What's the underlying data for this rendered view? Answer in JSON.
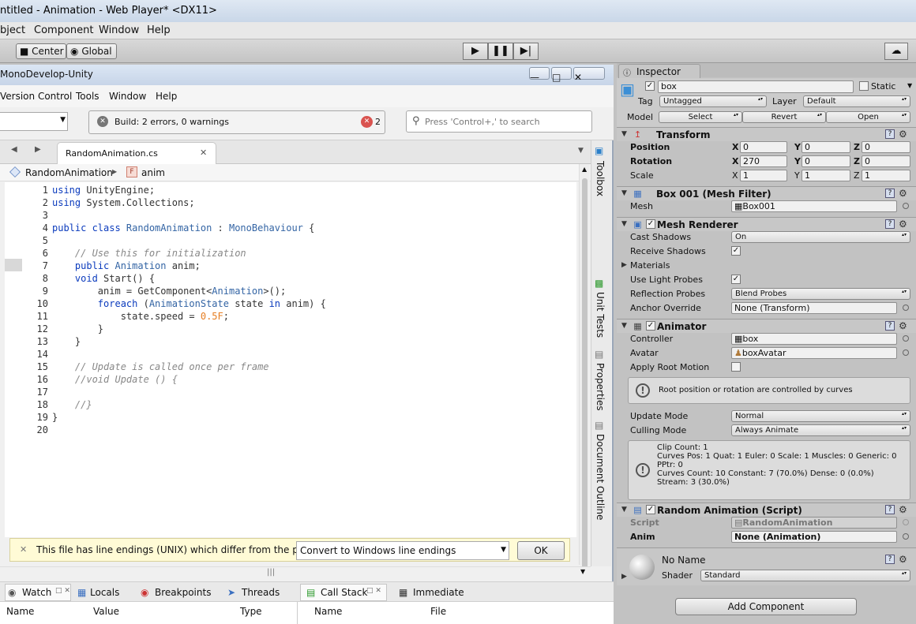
{
  "unity": {
    "title": "ntitled - Animation - Web Player* <DX11>",
    "menu": [
      "bject",
      "Component",
      "Window",
      "Help"
    ],
    "toolbar": {
      "center": "Center",
      "global": "Global"
    }
  },
  "md": {
    "title": "MonoDevelop-Unity",
    "menu": [
      "Version Control",
      "Tools",
      "Window",
      "Help"
    ],
    "build_status": "Build: 2 errors, 0 warnings",
    "error_count": "2",
    "search_placeholder": "Press 'Control+,' to search",
    "doc_tab": "RandomAnimation.cs",
    "breadcrumb_class": "RandomAnimation",
    "breadcrumb_member": "anim",
    "lines": [
      {
        "n": "1",
        "t": [
          [
            "kw",
            "using"
          ],
          [
            "",
            "UnityEngine;"
          ]
        ]
      },
      {
        "n": "2",
        "t": [
          [
            "kw",
            "using"
          ],
          [
            "",
            "System.Collections;"
          ]
        ]
      },
      {
        "n": "3",
        "t": []
      },
      {
        "n": "4",
        "t": [
          [
            "kw",
            "public class"
          ],
          [
            "ty",
            "RandomAnimation"
          ],
          [
            "",
            " : "
          ],
          [
            "ty",
            "MonoBehaviour"
          ],
          [
            "",
            " {"
          ]
        ]
      },
      {
        "n": "5",
        "t": []
      },
      {
        "n": "6",
        "t": [
          [
            "cm",
            "    // Use this for initialization"
          ]
        ]
      },
      {
        "n": "7",
        "t": [
          [
            "kw",
            "    public"
          ],
          [
            "ty",
            "Animation"
          ],
          [
            "",
            "anim;"
          ]
        ]
      },
      {
        "n": "8",
        "t": [
          [
            "kw",
            "    void"
          ],
          [
            "",
            "Start() {"
          ]
        ]
      },
      {
        "n": "9",
        "t": [
          [
            "",
            "        anim = GetComponent<"
          ],
          [
            "ty",
            "Animation"
          ],
          [
            "",
            ">();"
          ]
        ]
      },
      {
        "n": "10",
        "t": [
          [
            "kw",
            "        foreach"
          ],
          [
            "",
            " ("
          ],
          [
            "ty",
            "AnimationState"
          ],
          [
            "",
            "state "
          ],
          [
            "kw",
            "in"
          ],
          [
            "",
            "anim) {"
          ]
        ]
      },
      {
        "n": "11",
        "t": [
          [
            "",
            "            state.speed = "
          ],
          [
            "nm",
            "0.5F"
          ],
          [
            "",
            ";"
          ]
        ]
      },
      {
        "n": "12",
        "t": [
          [
            "",
            "        }"
          ]
        ]
      },
      {
        "n": "13",
        "t": [
          [
            "",
            "    }"
          ]
        ]
      },
      {
        "n": "14",
        "t": []
      },
      {
        "n": "15",
        "t": [
          [
            "cm",
            "    // Update is called once per frame"
          ]
        ]
      },
      {
        "n": "16",
        "t": [
          [
            "cm",
            "    //void Update () {"
          ]
        ]
      },
      {
        "n": "17",
        "t": []
      },
      {
        "n": "18",
        "t": [
          [
            "cm",
            "    //}"
          ]
        ]
      },
      {
        "n": "19",
        "t": [
          [
            "",
            "}"
          ]
        ]
      },
      {
        "n": "20",
        "t": []
      }
    ],
    "side_pads": [
      "Toolbox",
      "Unit Tests",
      "Properties",
      "Document Outline"
    ],
    "info_message": "This file has line endings (UNIX) which differ from the polic...",
    "convert_option": "Convert to Windows line endings",
    "ok": "OK",
    "pads": [
      "Watch",
      "Locals",
      "Breakpoints",
      "Threads",
      "Call Stack",
      "Immediate"
    ],
    "cols_left": [
      "Name",
      "Value",
      "Type"
    ],
    "cols_right": [
      "Name",
      "File"
    ]
  },
  "inspector": {
    "tab": "Inspector",
    "object_name": "box",
    "static": "Static",
    "tag_label": "Tag",
    "tag": "Untagged",
    "layer_label": "Layer",
    "layer": "Default",
    "model_label": "Model",
    "model_buttons": [
      "Select",
      "Revert",
      "Open"
    ],
    "transform": {
      "title": "Transform",
      "position": {
        "label": "Position",
        "x": "0",
        "y": "0",
        "z": "0"
      },
      "rotation": {
        "label": "Rotation",
        "x": "270",
        "y": "0",
        "z": "0"
      },
      "scale": {
        "label": "Scale",
        "x": "1",
        "y": "1",
        "z": "1"
      }
    },
    "mesh_filter": {
      "title": "Box 001 (Mesh Filter)",
      "mesh_label": "Mesh",
      "mesh": "Box001"
    },
    "mesh_renderer": {
      "title": "Mesh Renderer",
      "cast_label": "Cast Shadows",
      "cast": "On",
      "receive_label": "Receive Shadows",
      "materials_label": "Materials",
      "light_probes_label": "Use Light Probes",
      "reflection_label": "Reflection Probes",
      "reflection": "Blend Probes",
      "anchor_label": "Anchor Override",
      "anchor": "None (Transform)"
    },
    "animator": {
      "title": "Animator",
      "controller_label": "Controller",
      "controller": "box",
      "avatar_label": "Avatar",
      "avatar": "boxAvatar",
      "root_motion_label": "Apply Root Motion",
      "root_info": "Root position or rotation are controlled by curves",
      "update_label": "Update Mode",
      "update": "Normal",
      "culling_label": "Culling Mode",
      "culling": "Always Animate",
      "stats": [
        "Clip Count: 1",
        "Curves Pos: 1 Quat: 1 Euler: 0 Scale: 1 Muscles: 0 Generic: 0",
        "PPtr: 0",
        "Curves Count: 10 Constant: 7 (70.0%) Dense: 0 (0.0%)",
        "Stream: 3 (30.0%)"
      ]
    },
    "script": {
      "title": "Random Animation (Script)",
      "script_label": "Script",
      "script": "RandomAnimation",
      "anim_label": "Anim",
      "anim": "None (Animation)"
    },
    "material": {
      "name": "No Name",
      "shader_label": "Shader",
      "shader": "Standard"
    },
    "add_component": "Add Component"
  }
}
